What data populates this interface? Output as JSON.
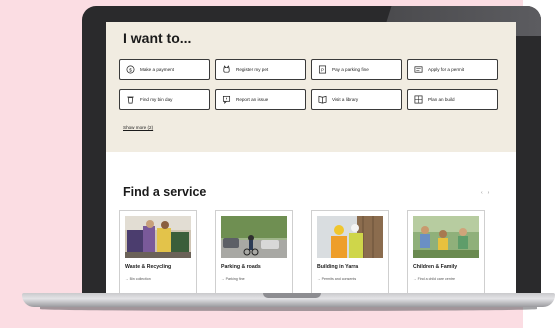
{
  "want": {
    "title": "I want to...",
    "actions": [
      {
        "label": "Make a payment",
        "icon": "dollar-icon"
      },
      {
        "label": "Register my pet",
        "icon": "pet-icon"
      },
      {
        "label": "Pay a parking fine",
        "icon": "parking-icon"
      },
      {
        "label": "Apply for a permit",
        "icon": "permit-icon"
      },
      {
        "label": "Find my bin day",
        "icon": "bin-icon"
      },
      {
        "label": "Report an issue",
        "icon": "report-icon"
      },
      {
        "label": "Visit a library",
        "icon": "library-icon"
      },
      {
        "label": "Plan an build",
        "icon": "build-icon"
      }
    ],
    "show_more": "Show more (2)"
  },
  "service": {
    "title": "Find a service",
    "prev_arrow": "‹",
    "next_arrow": "›",
    "cards": [
      {
        "title": "Waste & Recycling",
        "sub": "→ Bin collection"
      },
      {
        "title": "Parking & roads",
        "sub": "→ Parking fine"
      },
      {
        "title": "Building in Yarra",
        "sub": "→ Permits and consents"
      },
      {
        "title": "Children & Family",
        "sub": "→ Find a child care centre"
      }
    ]
  },
  "colors": {
    "page_background": "#fbdde3",
    "section_background": "#f1ece1",
    "laptop_frame": "#2a2a2c"
  }
}
